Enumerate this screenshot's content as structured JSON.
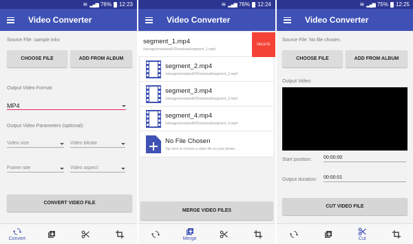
{
  "status": [
    {
      "battery": "76%",
      "time": "12:23"
    },
    {
      "battery": "76%",
      "time": "12:24"
    },
    {
      "battery": "75%",
      "time": "12:25"
    }
  ],
  "app_title": "Video Converter",
  "convert": {
    "source_file": "Source File: sample.mkv",
    "choose_file": "CHOOSE FILE",
    "add_from_album": "ADD FROM ALBUM",
    "output_format_label": "Output Video Format:",
    "output_format_value": "MP4",
    "params_label": "Output Video Parameters (optional):",
    "video_size": "Video size",
    "video_bitrate": "Video bitrate",
    "frame_rate": "Frame rate",
    "video_aspect": "Video aspect",
    "convert_button": "CONVERT VIDEO FILE"
  },
  "merge": {
    "segments": [
      {
        "name": "segment_1.mp4",
        "path": "/storage/emulated/0/Download/segment_1.mp4"
      },
      {
        "name": "segment_2.mp4",
        "path": "/storage/emulated/0/Download/segment_2.mp4"
      },
      {
        "name": "segment_3.mp4",
        "path": "/storage/emulated/0/Download/segment_3.mp4"
      },
      {
        "name": "segment_4.mp4",
        "path": "/storage/emulated/0/Download/segment_4.mp4"
      }
    ],
    "delete_label": "DELETE",
    "no_file_title": "No File Chosen",
    "no_file_hint": "Tap here to choose a video file on your phone.",
    "merge_button": "MERGE VIDEO FILES"
  },
  "cut": {
    "source_file": "Source File: No file chosen.",
    "choose_file": "CHOOSE FILE",
    "add_from_album": "ADD FROM ALBUM",
    "output_video_label": "Output Video:",
    "start_label": "Start position:",
    "start_value": "00:00:00",
    "duration_label": "Output duration:",
    "duration_value": "00:00:01",
    "cut_button": "CUT VIDEO FILE"
  },
  "nav": {
    "convert": "Convert",
    "merge": "Merge",
    "cut": "Cut"
  },
  "colors": {
    "primary": "#3f51b5",
    "status": "#2c3691",
    "delete": "#f44336",
    "accent_underline": "#e91e63"
  },
  "icons": [
    "menu-icon",
    "convert-icon",
    "merge-icon",
    "cut-icon",
    "crop-icon",
    "film-icon",
    "add-file-icon",
    "wifi-icon",
    "signal-icon",
    "battery-icon"
  ]
}
